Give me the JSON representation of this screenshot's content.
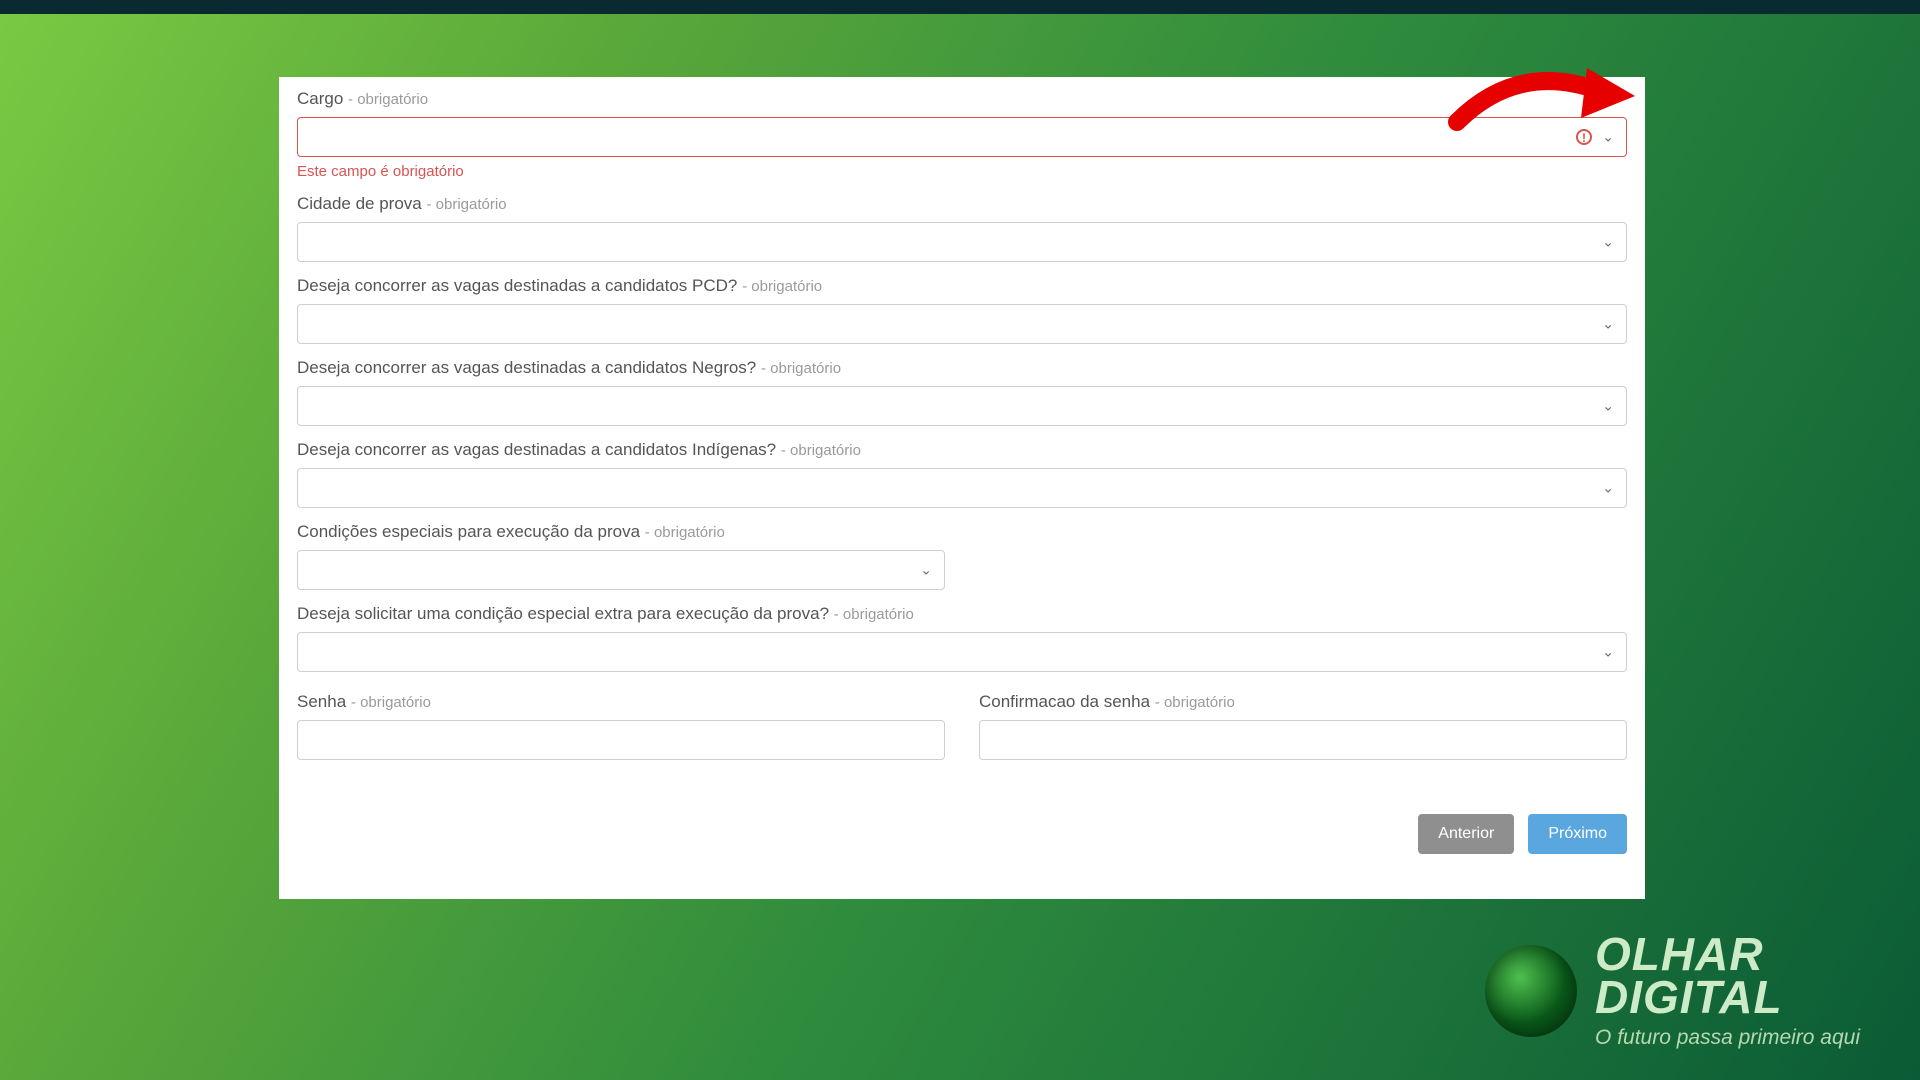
{
  "required_suffix": "- obrigatório",
  "fields": {
    "cargo": {
      "label": "Cargo",
      "error": "Este campo é obrigatório"
    },
    "cidade": {
      "label": "Cidade de prova"
    },
    "pcd": {
      "label": "Deseja concorrer as vagas destinadas a candidatos PCD?"
    },
    "negros": {
      "label": "Deseja concorrer as vagas destinadas a candidatos Negros?"
    },
    "indigenas": {
      "label": "Deseja concorrer as vagas destinadas a candidatos Indígenas?"
    },
    "condicoes": {
      "label": "Condições especiais para execução da prova"
    },
    "extra": {
      "label": "Deseja solicitar uma condição especial extra para execução da prova?"
    },
    "senha": {
      "label": "Senha"
    },
    "confirmacao": {
      "label": "Confirmacao da senha"
    }
  },
  "buttons": {
    "prev": "Anterior",
    "next": "Próximo"
  },
  "brand": {
    "name1": "OLHAR",
    "name2": "DIGITAL",
    "tagline": "O futuro passa primeiro aqui"
  }
}
